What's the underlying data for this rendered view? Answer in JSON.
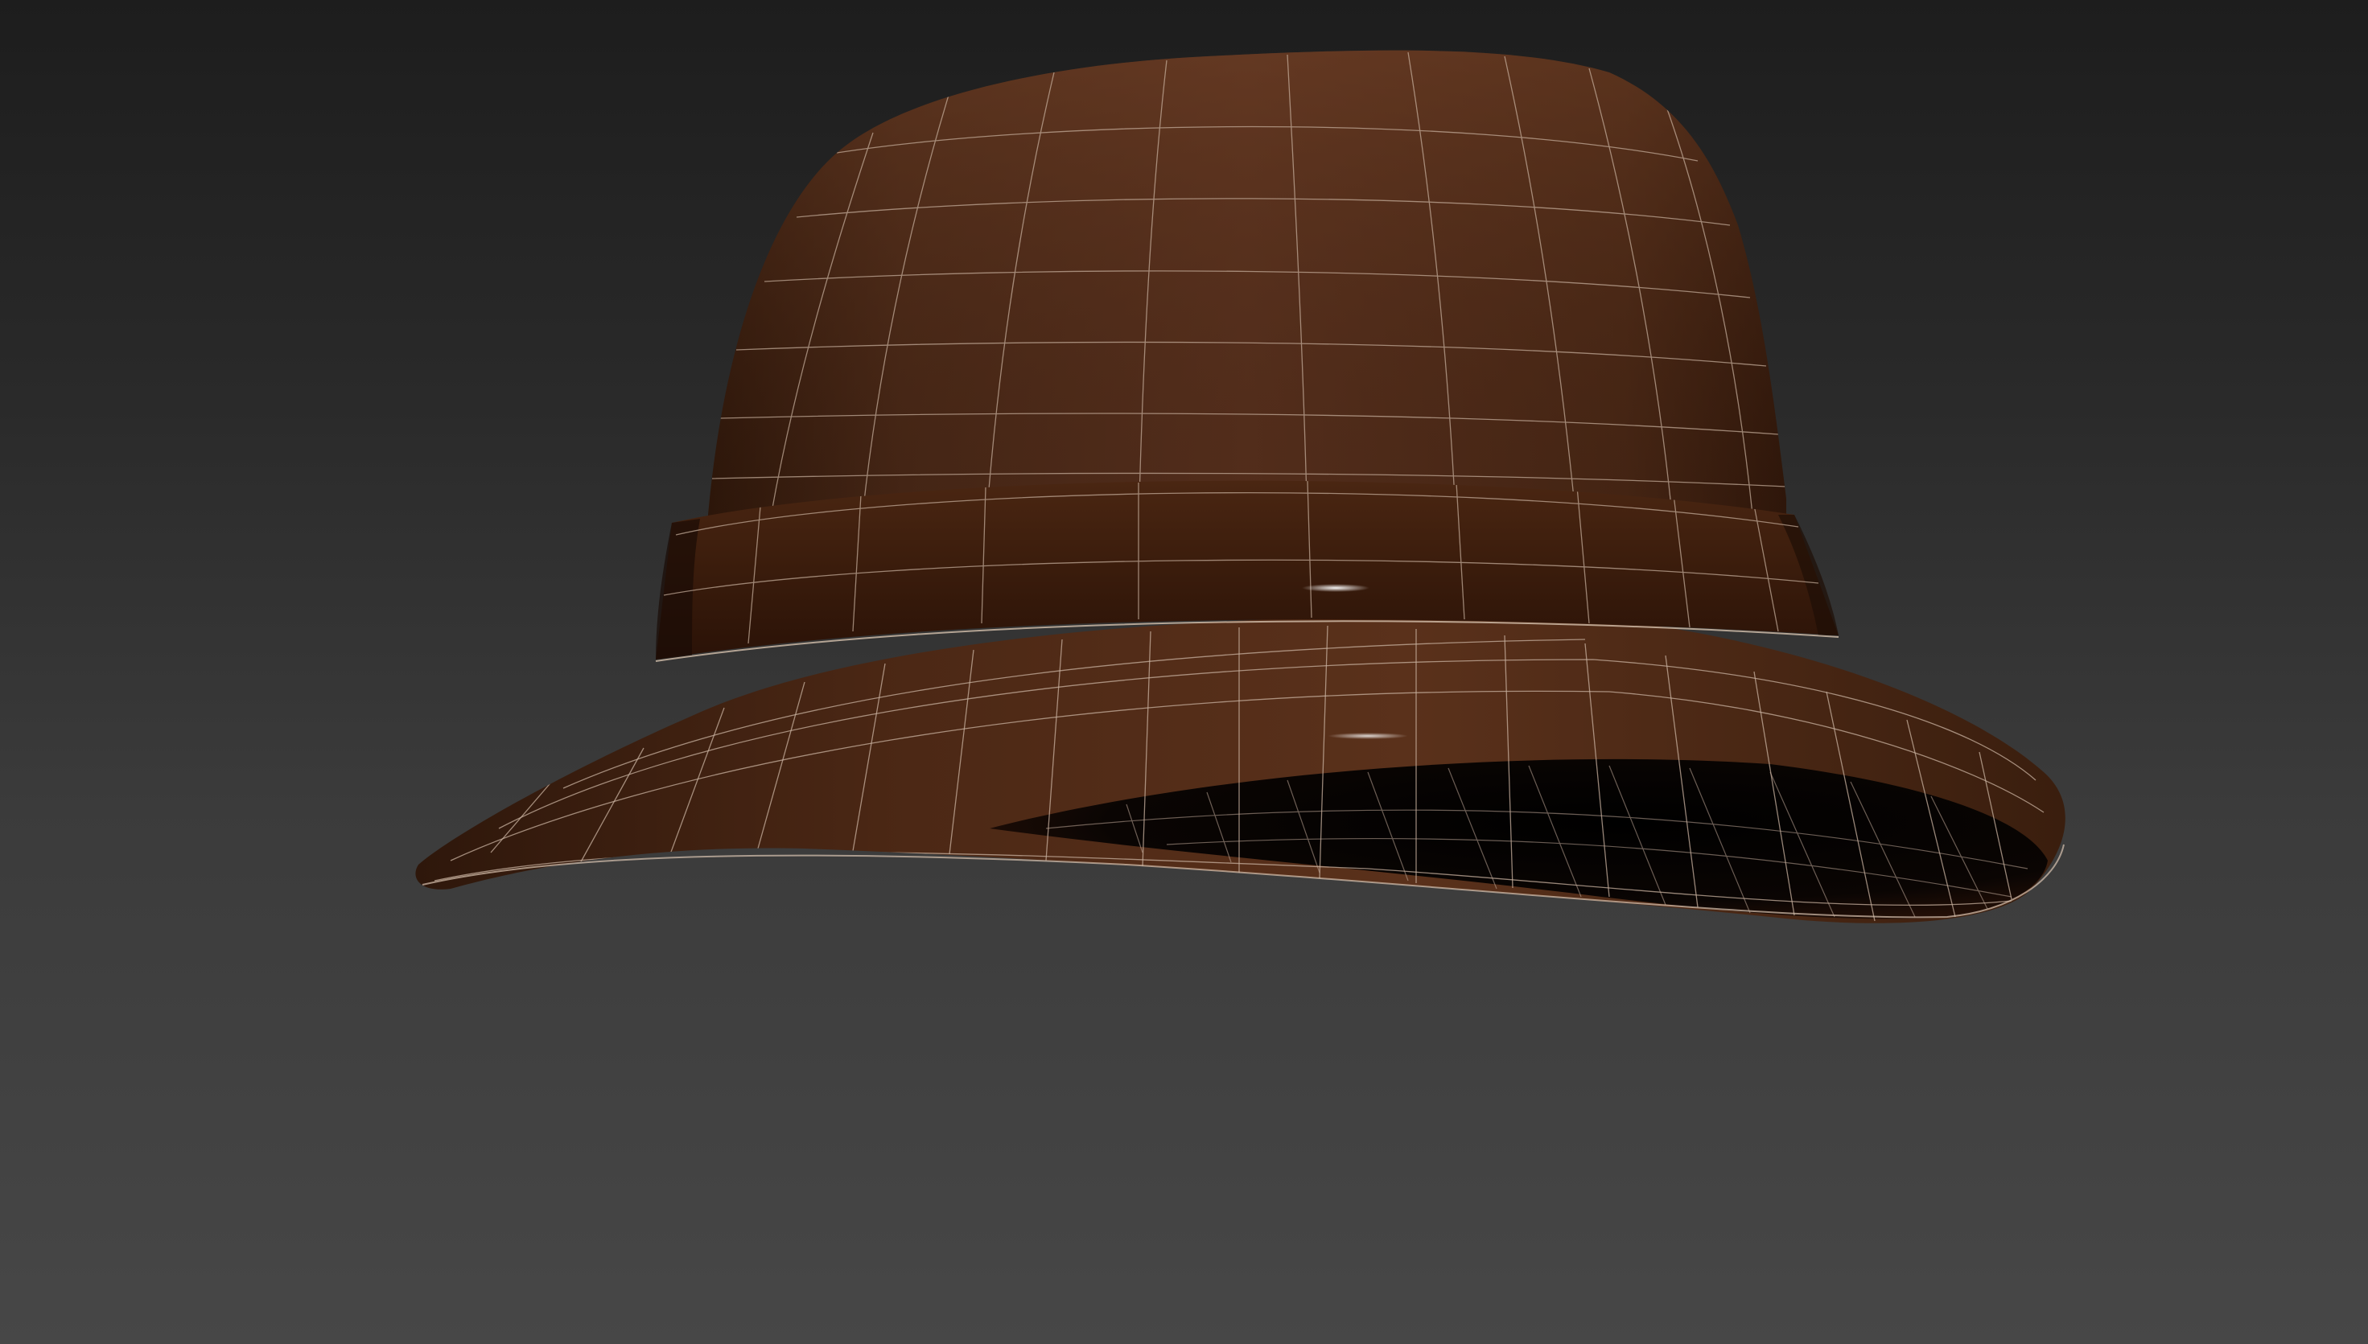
{
  "viewport": {
    "background_top": "#1d1d1d",
    "background_bottom": "#474747"
  },
  "model": {
    "object": "hat-mesh",
    "display": "shaded-with-wireframe",
    "material_color": "#5a3220",
    "material_shadow": "#2a1409",
    "wire_color": "#c9b2a0"
  }
}
